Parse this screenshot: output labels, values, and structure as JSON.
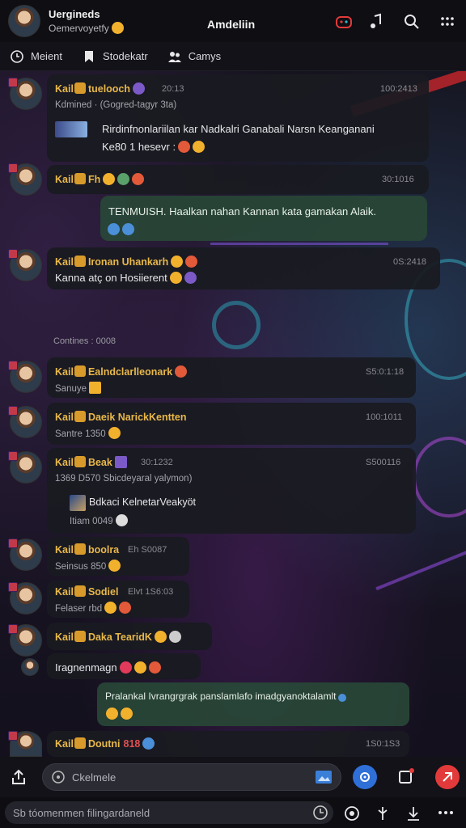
{
  "header": {
    "channel_name": "Uergineds",
    "channel_sub": "Oemervoyetfy",
    "title": "Amdeliin"
  },
  "filters": [
    {
      "label": "Meient",
      "icon": "clock-icon"
    },
    {
      "label": "Stodekatr",
      "icon": "bookmark-icon"
    },
    {
      "label": "Camys",
      "icon": "people-icon"
    }
  ],
  "system_line": "Contines : 0008",
  "messages": [
    {
      "id": "m1",
      "name": "Kail",
      "title": "tuelooch",
      "time": "20:13",
      "time_right": "100:2413",
      "line2": "Kdmined  ·  (Gogred-tagyr 3ta)",
      "quote": "Rirdinfnonlariilan kar Nadkalri Ganabali Narsn Keanganani",
      "line4": "Ke80  1 hesevr :"
    },
    {
      "id": "m2",
      "name": "Kail",
      "title": "Fh",
      "time": "",
      "time_right": "30:1016"
    },
    {
      "id": "m3",
      "own": true,
      "text": "TENMUISH. Haalkan nahan Kannan kata gamakan Alaik."
    },
    {
      "id": "m4",
      "name": "Kail",
      "title": "Ironan Uhankarh",
      "time_right": "0S:2418",
      "text": "Kanna atç on Hosiierent"
    },
    {
      "id": "m5",
      "name": "Kail",
      "title": "Ealndclarlleonark",
      "time_right": "S5:0:1:18",
      "subtext": "Sanuye"
    },
    {
      "id": "m6",
      "name": "Kail",
      "title": "Daeik NarickKentten",
      "time_right": "100:1011",
      "subtext": "Santre  1350"
    },
    {
      "id": "m7",
      "name": "Kail",
      "title": "Beak",
      "time": "30:1232",
      "time_right": "S500116",
      "line2": "1369  D570  Sbicdeyaral yalymon)",
      "quote": "Bdkaci KelnetarVeakyöt",
      "line4": "Itiam  0049"
    },
    {
      "id": "m8",
      "name": "Kail",
      "title": "boolra",
      "time": "Eh  S0087",
      "subtext": "Seinsus  850"
    },
    {
      "id": "m9",
      "name": "Kail",
      "title": "Sodiel",
      "time": "Elvt  1S6:03",
      "subtext": "Felaser  rbd"
    },
    {
      "id": "m10",
      "name": "Kail",
      "title": "Daka TearidK",
      "text": "Iragnenmagn"
    },
    {
      "id": "m11",
      "own": true,
      "text": "Pralankal Ivrangrgrak panslamlafo imadgyanoktalamlt"
    },
    {
      "id": "m12",
      "name": "Kail",
      "title": "Doutni",
      "time": "818",
      "time_right": "1S0:1S3"
    }
  ],
  "composer": {
    "placeholder": "Ckelmele"
  },
  "search": {
    "placeholder": "Sb tóomenmen filingardaneld"
  },
  "colors": {
    "accent": "#e8b84a",
    "own_bubble": "#284637",
    "bubble": "#1a1b21",
    "send": "#e23a3a",
    "voice": "#2f6fd8"
  }
}
